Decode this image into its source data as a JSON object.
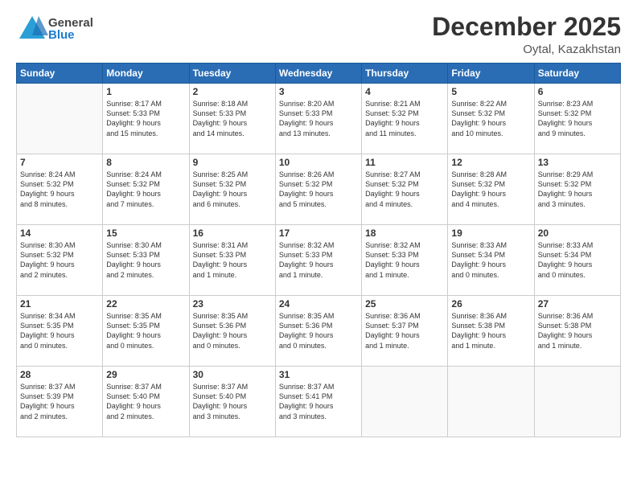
{
  "header": {
    "logo_general": "General",
    "logo_blue": "Blue",
    "month": "December 2025",
    "location": "Oytal, Kazakhstan"
  },
  "weekdays": [
    "Sunday",
    "Monday",
    "Tuesday",
    "Wednesday",
    "Thursday",
    "Friday",
    "Saturday"
  ],
  "weeks": [
    [
      {
        "day": "",
        "info": ""
      },
      {
        "day": "1",
        "info": "Sunrise: 8:17 AM\nSunset: 5:33 PM\nDaylight: 9 hours\nand 15 minutes."
      },
      {
        "day": "2",
        "info": "Sunrise: 8:18 AM\nSunset: 5:33 PM\nDaylight: 9 hours\nand 14 minutes."
      },
      {
        "day": "3",
        "info": "Sunrise: 8:20 AM\nSunset: 5:33 PM\nDaylight: 9 hours\nand 13 minutes."
      },
      {
        "day": "4",
        "info": "Sunrise: 8:21 AM\nSunset: 5:32 PM\nDaylight: 9 hours\nand 11 minutes."
      },
      {
        "day": "5",
        "info": "Sunrise: 8:22 AM\nSunset: 5:32 PM\nDaylight: 9 hours\nand 10 minutes."
      },
      {
        "day": "6",
        "info": "Sunrise: 8:23 AM\nSunset: 5:32 PM\nDaylight: 9 hours\nand 9 minutes."
      }
    ],
    [
      {
        "day": "7",
        "info": "Sunrise: 8:24 AM\nSunset: 5:32 PM\nDaylight: 9 hours\nand 8 minutes."
      },
      {
        "day": "8",
        "info": "Sunrise: 8:24 AM\nSunset: 5:32 PM\nDaylight: 9 hours\nand 7 minutes."
      },
      {
        "day": "9",
        "info": "Sunrise: 8:25 AM\nSunset: 5:32 PM\nDaylight: 9 hours\nand 6 minutes."
      },
      {
        "day": "10",
        "info": "Sunrise: 8:26 AM\nSunset: 5:32 PM\nDaylight: 9 hours\nand 5 minutes."
      },
      {
        "day": "11",
        "info": "Sunrise: 8:27 AM\nSunset: 5:32 PM\nDaylight: 9 hours\nand 4 minutes."
      },
      {
        "day": "12",
        "info": "Sunrise: 8:28 AM\nSunset: 5:32 PM\nDaylight: 9 hours\nand 4 minutes."
      },
      {
        "day": "13",
        "info": "Sunrise: 8:29 AM\nSunset: 5:32 PM\nDaylight: 9 hours\nand 3 minutes."
      }
    ],
    [
      {
        "day": "14",
        "info": "Sunrise: 8:30 AM\nSunset: 5:32 PM\nDaylight: 9 hours\nand 2 minutes."
      },
      {
        "day": "15",
        "info": "Sunrise: 8:30 AM\nSunset: 5:33 PM\nDaylight: 9 hours\nand 2 minutes."
      },
      {
        "day": "16",
        "info": "Sunrise: 8:31 AM\nSunset: 5:33 PM\nDaylight: 9 hours\nand 1 minute."
      },
      {
        "day": "17",
        "info": "Sunrise: 8:32 AM\nSunset: 5:33 PM\nDaylight: 9 hours\nand 1 minute."
      },
      {
        "day": "18",
        "info": "Sunrise: 8:32 AM\nSunset: 5:33 PM\nDaylight: 9 hours\nand 1 minute."
      },
      {
        "day": "19",
        "info": "Sunrise: 8:33 AM\nSunset: 5:34 PM\nDaylight: 9 hours\nand 0 minutes."
      },
      {
        "day": "20",
        "info": "Sunrise: 8:33 AM\nSunset: 5:34 PM\nDaylight: 9 hours\nand 0 minutes."
      }
    ],
    [
      {
        "day": "21",
        "info": "Sunrise: 8:34 AM\nSunset: 5:35 PM\nDaylight: 9 hours\nand 0 minutes."
      },
      {
        "day": "22",
        "info": "Sunrise: 8:35 AM\nSunset: 5:35 PM\nDaylight: 9 hours\nand 0 minutes."
      },
      {
        "day": "23",
        "info": "Sunrise: 8:35 AM\nSunset: 5:36 PM\nDaylight: 9 hours\nand 0 minutes."
      },
      {
        "day": "24",
        "info": "Sunrise: 8:35 AM\nSunset: 5:36 PM\nDaylight: 9 hours\nand 0 minutes."
      },
      {
        "day": "25",
        "info": "Sunrise: 8:36 AM\nSunset: 5:37 PM\nDaylight: 9 hours\nand 1 minute."
      },
      {
        "day": "26",
        "info": "Sunrise: 8:36 AM\nSunset: 5:38 PM\nDaylight: 9 hours\nand 1 minute."
      },
      {
        "day": "27",
        "info": "Sunrise: 8:36 AM\nSunset: 5:38 PM\nDaylight: 9 hours\nand 1 minute."
      }
    ],
    [
      {
        "day": "28",
        "info": "Sunrise: 8:37 AM\nSunset: 5:39 PM\nDaylight: 9 hours\nand 2 minutes."
      },
      {
        "day": "29",
        "info": "Sunrise: 8:37 AM\nSunset: 5:40 PM\nDaylight: 9 hours\nand 2 minutes."
      },
      {
        "day": "30",
        "info": "Sunrise: 8:37 AM\nSunset: 5:40 PM\nDaylight: 9 hours\nand 3 minutes."
      },
      {
        "day": "31",
        "info": "Sunrise: 8:37 AM\nSunset: 5:41 PM\nDaylight: 9 hours\nand 3 minutes."
      },
      {
        "day": "",
        "info": ""
      },
      {
        "day": "",
        "info": ""
      },
      {
        "day": "",
        "info": ""
      }
    ]
  ]
}
